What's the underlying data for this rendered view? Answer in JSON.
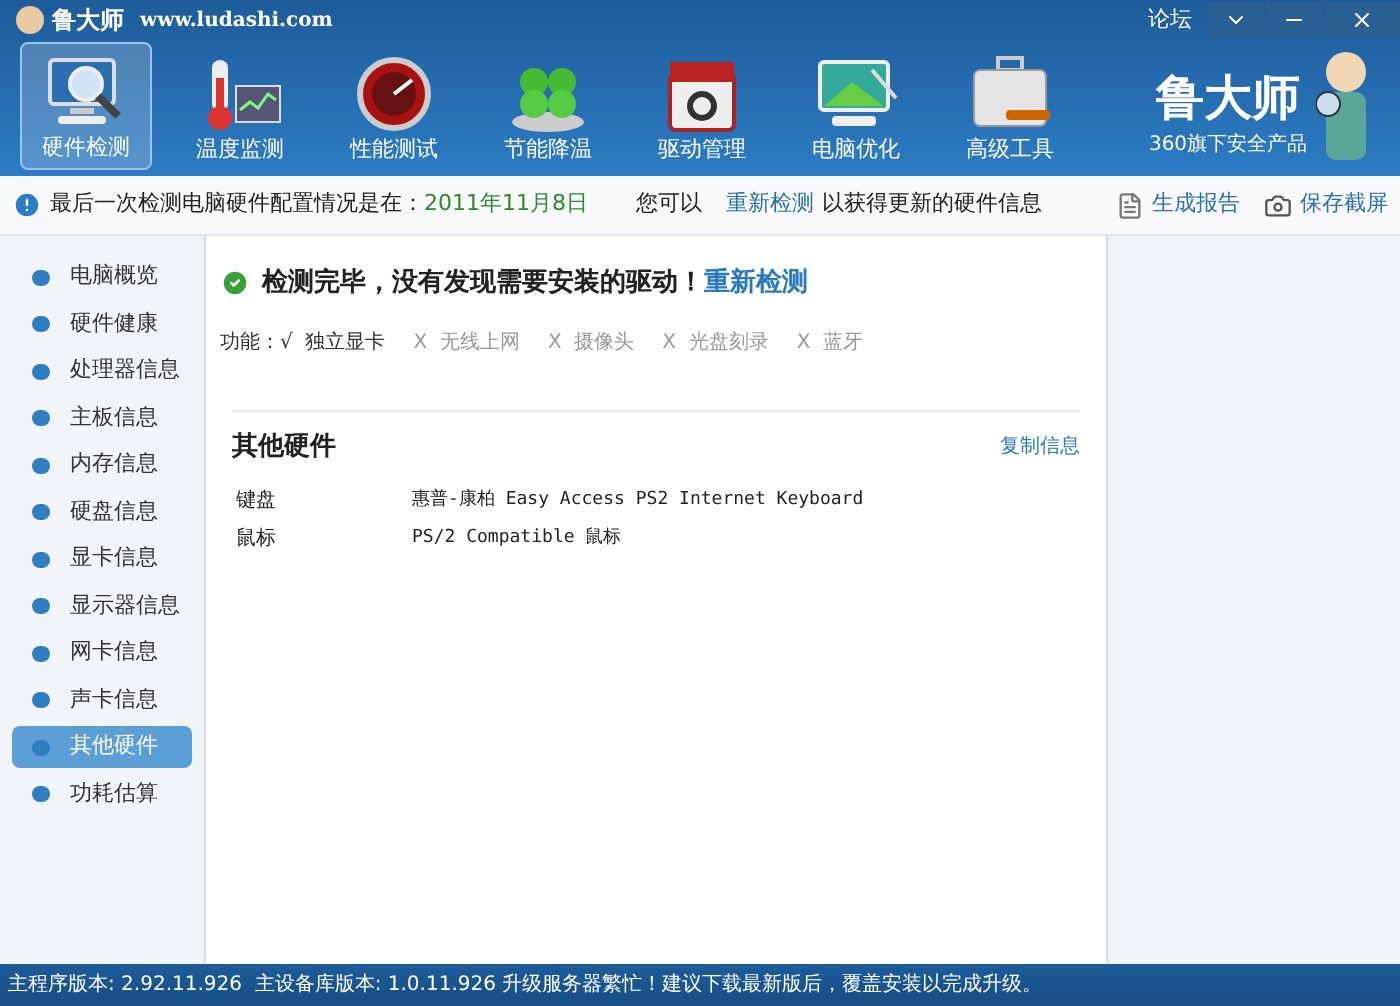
{
  "window": {
    "title": "鲁大师",
    "url": "www.ludashi.com",
    "forum_link": "论坛"
  },
  "toolbar": [
    {
      "label": "硬件检测",
      "kind": "monitor",
      "selected": true
    },
    {
      "label": "温度监测",
      "kind": "thermo",
      "selected": false
    },
    {
      "label": "性能测试",
      "kind": "gauge",
      "selected": false
    },
    {
      "label": "节能降温",
      "kind": "clover",
      "selected": false
    },
    {
      "label": "驱动管理",
      "kind": "box",
      "selected": false
    },
    {
      "label": "电脑优化",
      "kind": "screen",
      "selected": false
    },
    {
      "label": "高级工具",
      "kind": "toolbox",
      "selected": false
    }
  ],
  "brand": {
    "logo": "鲁大师",
    "tagline": "360旗下安全产品"
  },
  "info_bar": {
    "text": "最后一次检测电脑硬件配置情况是在：",
    "date": "2011年11月8日",
    "hint_before": "您可以",
    "link": "重新检测",
    "hint_after": "以获得更新的硬件信息",
    "actions": [
      "生成报告",
      "保存截屏"
    ]
  },
  "sidebar": {
    "items": [
      {
        "label": "电脑概览",
        "selected": false
      },
      {
        "label": "硬件健康",
        "selected": false
      },
      {
        "label": "处理器信息",
        "selected": false
      },
      {
        "label": "主板信息",
        "selected": false
      },
      {
        "label": "内存信息",
        "selected": false
      },
      {
        "label": "硬盘信息",
        "selected": false
      },
      {
        "label": "显卡信息",
        "selected": false
      },
      {
        "label": "显示器信息",
        "selected": false
      },
      {
        "label": "网卡信息",
        "selected": false
      },
      {
        "label": "声卡信息",
        "selected": false
      },
      {
        "label": "其他硬件",
        "selected": true
      },
      {
        "label": "功耗估算",
        "selected": false
      }
    ]
  },
  "result": {
    "message": "检测完毕，没有发现需要安装的驱动！",
    "link": "重新检测",
    "features_label": "功能：",
    "features": [
      {
        "mark": "√",
        "label": "独立显卡",
        "available": true
      },
      {
        "mark": "X",
        "label": "无线上网",
        "available": false
      },
      {
        "mark": "X",
        "label": "摄像头",
        "available": false
      },
      {
        "mark": "X",
        "label": "光盘刻录",
        "available": false
      },
      {
        "mark": "X",
        "label": "蓝牙",
        "available": false
      }
    ]
  },
  "section": {
    "title": "其他硬件",
    "action": "复制信息",
    "rows": [
      {
        "name": "键盘",
        "value": "惠普-康柏 Easy Access PS2 Internet Keyboard"
      },
      {
        "name": "鼠标",
        "value": "PS/2 Compatible 鼠标"
      }
    ]
  },
  "status_bar": "主程序版本: 2.92.11.926  主设备库版本: 1.0.11.926 升级服务器繁忙！建议下载最新版后，覆盖安装以完成升级。"
}
